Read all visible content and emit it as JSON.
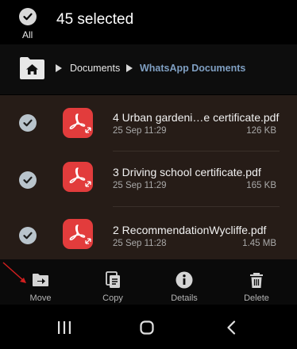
{
  "header": {
    "select_all_label": "All",
    "selected_count": "45 selected"
  },
  "breadcrumb": {
    "items": [
      "Documents",
      "WhatsApp Documents"
    ]
  },
  "files": [
    {
      "name": "4 Urban gardeni…e certificate.pdf",
      "date": "25 Sep 11:29",
      "size": "126 KB",
      "selected": true
    },
    {
      "name": "3 Driving school certificate.pdf",
      "date": "25 Sep 11:29",
      "size": "165 KB",
      "selected": true
    },
    {
      "name": "2 RecommendationWycliffe.pdf",
      "date": "25 Sep 11:28",
      "size": "1.45 MB",
      "selected": true
    }
  ],
  "actions": {
    "move": "Move",
    "copy": "Copy",
    "details": "Details",
    "delete": "Delete"
  },
  "colors": {
    "accent_link": "#7f9fc2",
    "pdf_red": "#e23c3c",
    "list_bg": "#261c17",
    "annotation_arrow": "#d11f1f"
  },
  "icons": {
    "check": "check-icon",
    "home": "home-folder-icon",
    "pdf": "pdf-icon",
    "move": "move-folder-icon",
    "copy": "copy-icon",
    "details": "info-icon",
    "delete": "trash-icon",
    "recents": "recents-icon",
    "home_nav": "home-nav-icon",
    "back": "back-icon"
  }
}
